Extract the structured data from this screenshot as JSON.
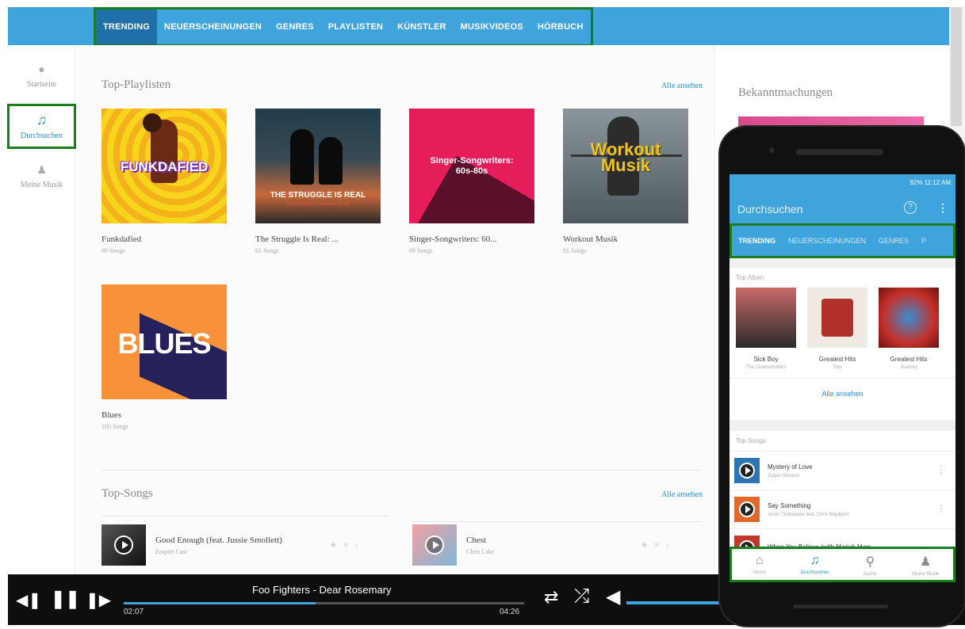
{
  "nav": {
    "tabs": [
      "TRENDING",
      "NEUERSCHEINUNGEN",
      "GENRES",
      "PLAYLISTEN",
      "KÜNSTLER",
      "MUSIKVIDEOS",
      "HÖRBUCH"
    ],
    "active_tab": "TRENDING"
  },
  "sidebar": {
    "items": [
      {
        "label": "Startseite",
        "icon": "home-icon"
      },
      {
        "label": "Durchsuchen",
        "icon": "music-note-icon"
      },
      {
        "label": "Meine Musik",
        "icon": "person-icon"
      }
    ],
    "active": "Durchsuchen"
  },
  "playlists": {
    "title": "Top-Playlisten",
    "see_all": "Alle ansehen",
    "items": [
      {
        "title": "Funkdafied",
        "count": "80 Songs",
        "cover_text": "FUNKDAFIED",
        "color": "#f5d220"
      },
      {
        "title": "The Struggle Is Real: ...",
        "count": "61 Songs",
        "cover_text": "THE STRUGGLE IS REAL",
        "cover_sub": "SONGS ABOUT HAVING A CRUSH",
        "color": "#2a2a2a"
      },
      {
        "title": "Singer-Songwriters: 60...",
        "count": "69 Songs",
        "cover_text": "Singer-Songwriters: 60s-80s",
        "color": "#e51e5a"
      },
      {
        "title": "Workout Musik",
        "count": "81 Songs",
        "cover_text": "Workout Musik",
        "color": "#6e7a82"
      },
      {
        "title": "Blues",
        "count": "100 Songs",
        "cover_text": "BLUES",
        "color": "#f7923a"
      }
    ]
  },
  "songs": {
    "title": "Top-Songs",
    "see_all": "Alle ansehen",
    "items": [
      {
        "title": "Good Enough (feat. Jussie Smollett)",
        "artist": "Empire Cast"
      },
      {
        "title": "Chest",
        "artist": "Chris Lake"
      }
    ]
  },
  "announcements": {
    "title": "Bekanntmachungen"
  },
  "player": {
    "track": "Foo Fighters - Dear Rosemary",
    "elapsed": "02:07",
    "duration": "04:26",
    "progress": 0.48
  },
  "mobile": {
    "status": "92% 11:12 AM",
    "title": "Durchsuchen",
    "tabs": [
      "TRENDING",
      "NEUERSCHEINUNGEN",
      "GENRES",
      "P"
    ],
    "albums_title": "Top Alben",
    "albums": [
      {
        "title": "Sick Boy",
        "artist": "The Chainsmokers"
      },
      {
        "title": "Greatest Hits",
        "artist": "Toto"
      },
      {
        "title": "Greatest Hits",
        "artist": "Journey"
      }
    ],
    "see_all": "Alle ansehen",
    "songs_title": "Top Songs",
    "songs": [
      {
        "title": "Mystery of Love",
        "artist": "Sufjan Stevens"
      },
      {
        "title": "Say Something",
        "artist": "Justin Timberlake feat. Chris Stapleton"
      },
      {
        "title": "When You Believe (with Mariah Mars...",
        "artist": ""
      }
    ],
    "nav": [
      "Home",
      "Durchsuchen",
      "Suche",
      "Meine Musik"
    ],
    "nav_active": "Durchsuchen"
  }
}
